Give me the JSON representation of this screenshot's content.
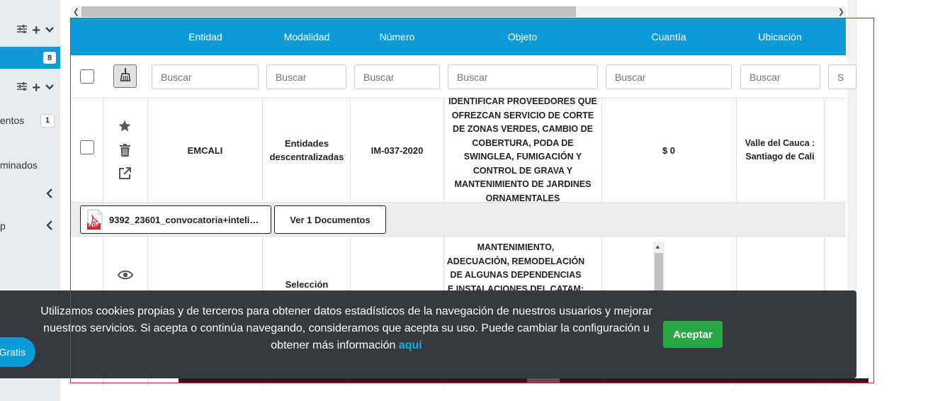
{
  "sidebar": {
    "badge_active": "8",
    "item_documentos": {
      "label": "entos",
      "count": "1"
    },
    "item_eliminados": {
      "label": "minados"
    },
    "item_p": {
      "label": "p"
    },
    "gratis_button": "Gratis"
  },
  "table": {
    "headers": [
      "Entidad",
      "Modalidad",
      "Número",
      "Objeto",
      "Cuantía",
      "Ubicación"
    ],
    "search_placeholder": "Buscar",
    "row1": {
      "entidad": "EMCALI",
      "modalidad": "Entidades descentralizadas",
      "numero": "IM-037-2020",
      "objeto": "IDENTIFICAR PROVEEDORES QUE OFREZCAN SERVICIO DE CORTE DE ZONAS VERDES, CAMBIO DE COBERTURA, PODA DE SWINGLEA, FUMIGACIÓN Y CONTROL DE GRAVA Y MANTENIMIENTO DE JARDINES ORNAMENTALES",
      "cuantia": "$ 0",
      "ubicacion": "Valle del Cauca : Santiago de Cali"
    },
    "row1_docs": {
      "file_name": "9392_23601_convocatoria+inteli…",
      "view_docs": "Ver 1 Documentos",
      "file_icon_label": "PDF"
    },
    "row2": {
      "modalidad": "Selección",
      "objeto": "MANTENIMIENTO, ADECUACIÓN, REMODELACIÓN DE ALGUNAS DEPENDENCIAS E INSTALACIONES DEL CATAM:"
    },
    "partial_search_letter": "S"
  },
  "cookie_banner": {
    "text": "Utilizamos cookies propias y de terceros para obtener datos estadísticos de la navegación de nuestros usuarios y mejorar nuestros servicios. Si acepta o continúa navegando, consideramos que acepta su uso. Puede cambiar la configuración u obtener más información",
    "link": "aquí",
    "accept_button": "Aceptar"
  },
  "colors": {
    "header_blue": "#0b9bd9",
    "accept_green": "#28a745",
    "banner_dark": "#363a3f",
    "frame_red": "#d9232d"
  }
}
